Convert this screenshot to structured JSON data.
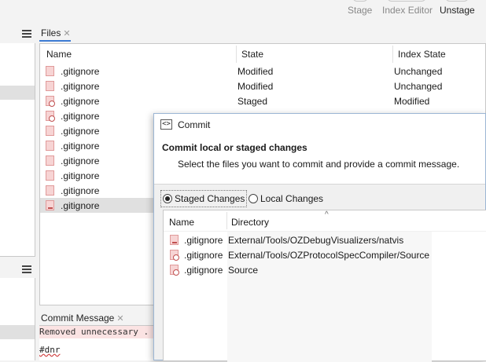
{
  "toolbar": {
    "stage_label": "Stage",
    "index_editor_label": "Index Editor",
    "unstage_label": "Unstage"
  },
  "files_tab": {
    "label": "Files",
    "close": "✕"
  },
  "files_table": {
    "columns": [
      "Name",
      "State",
      "Index State"
    ],
    "rows": [
      {
        "name": ".gitignore",
        "state": "Modified",
        "index_state": "Unchanged",
        "icon": "file-modified-icon"
      },
      {
        "name": ".gitignore",
        "state": "Modified",
        "index_state": "Unchanged",
        "icon": "file-modified-icon"
      },
      {
        "name": ".gitignore",
        "state": "Staged",
        "index_state": "Modified",
        "icon": "file-staged-icon"
      },
      {
        "name": ".gitignore",
        "state": "",
        "index_state": "",
        "icon": "file-staged-icon"
      },
      {
        "name": ".gitignore",
        "state": "",
        "index_state": "",
        "icon": "file-modified-icon"
      },
      {
        "name": ".gitignore",
        "state": "",
        "index_state": "",
        "icon": "file-modified-icon"
      },
      {
        "name": ".gitignore",
        "state": "",
        "index_state": "",
        "icon": "file-modified-icon"
      },
      {
        "name": ".gitignore",
        "state": "",
        "index_state": "",
        "icon": "file-modified-icon"
      },
      {
        "name": ".gitignore",
        "state": "",
        "index_state": "",
        "icon": "file-modified-icon"
      },
      {
        "name": ".gitignore",
        "state": "",
        "index_state": "",
        "icon": "file-unstaged-icon"
      }
    ],
    "selected_index": 9
  },
  "commit_message": {
    "tab_label": "Commit Message",
    "close": "✕",
    "line1": "Removed unnecessary .",
    "line2": "#dnr"
  },
  "commit_dialog": {
    "title": "Commit",
    "icon_glyph": "<>",
    "heading": "Commit local or staged changes",
    "subheading": "Select the files you want to commit and provide a commit message.",
    "radio_staged": "Staged Changes",
    "radio_local": "Local Changes",
    "selected_radio": "staged",
    "columns": [
      "Name",
      "Directory"
    ],
    "rows": [
      {
        "name": ".gitignore",
        "directory": "External/Tools/OZDebugVisualizers/natvis"
      },
      {
        "name": ".gitignore",
        "directory": "External/Tools/OZProtocolSpecCompiler/Source"
      },
      {
        "name": ".gitignore",
        "directory": "Source"
      }
    ]
  },
  "colors": {
    "selection": "#e0e0e0",
    "file_icon_fill": "#f7d4d4",
    "file_icon_border": "#e09a9a",
    "dialog_border": "#9cb6d4"
  }
}
